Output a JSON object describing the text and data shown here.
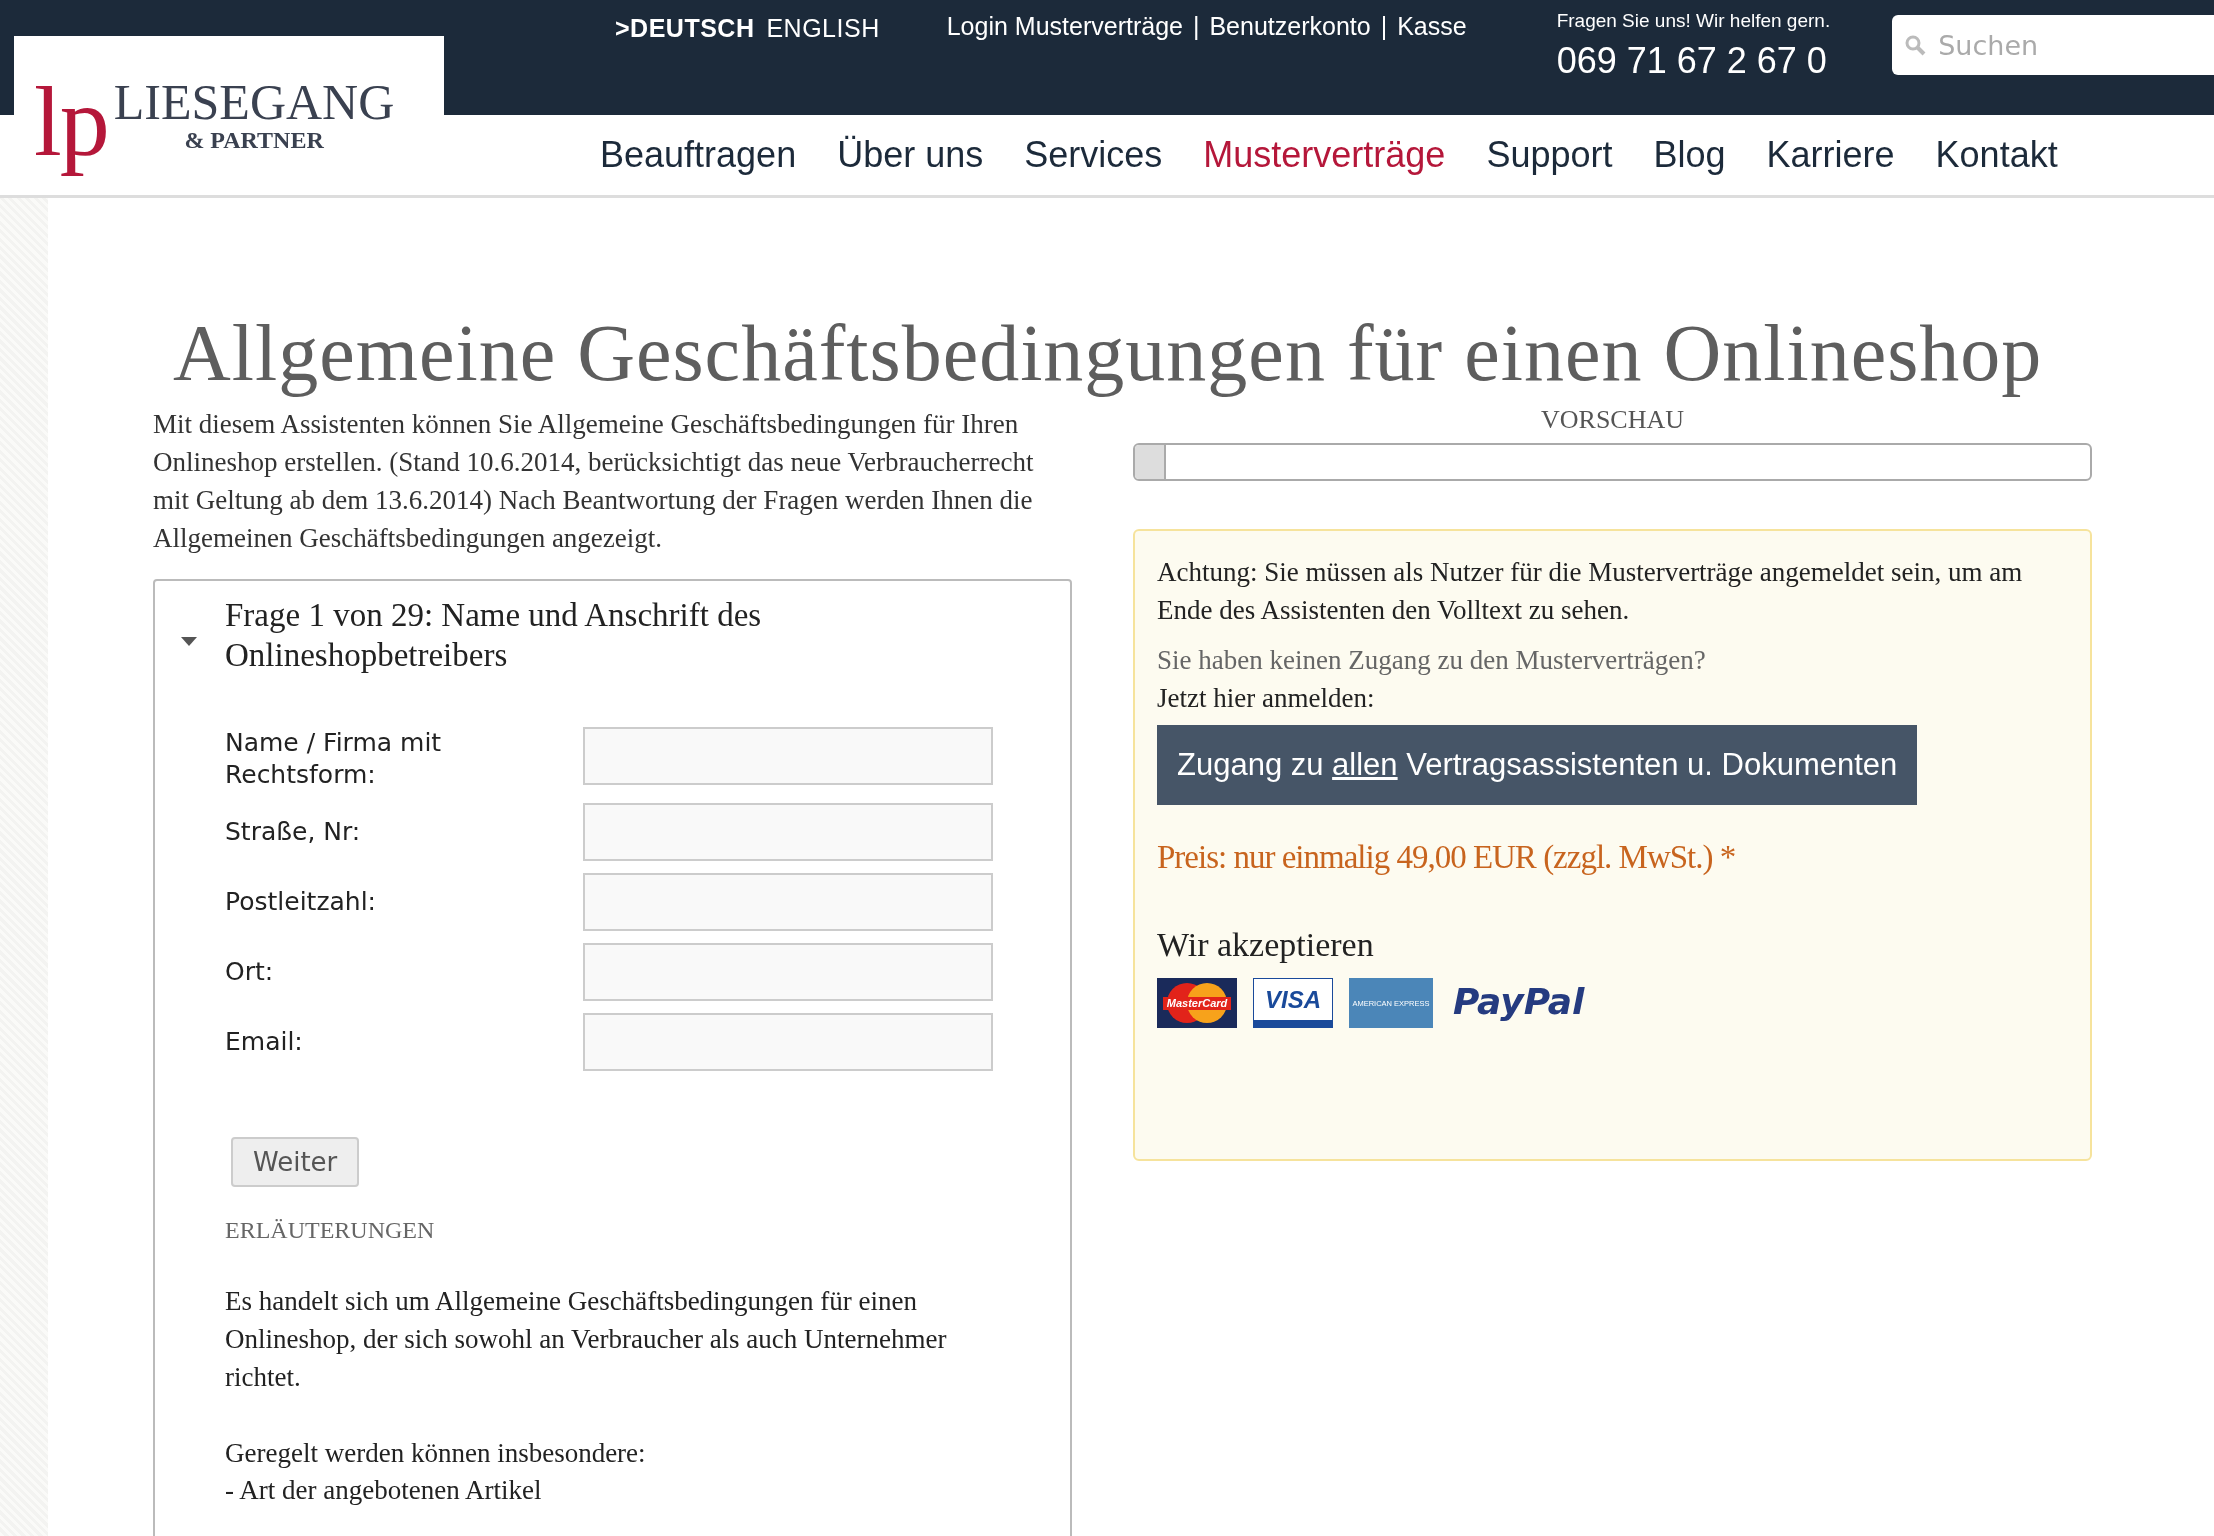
{
  "logo": {
    "initials": "lp",
    "name": "LIESEGANG",
    "subtitle": "& PARTNER"
  },
  "languages": [
    {
      "label": ">DEUTSCH",
      "selected": true
    },
    {
      "label": "ENGLISH",
      "selected": false
    }
  ],
  "account_links": [
    "Login Musterverträge",
    "Benutzerkonto",
    "Kasse"
  ],
  "link_separator": "|",
  "help_text": "Fragen Sie uns! Wir helfen gern.",
  "phone": "069 71 67 2 67 0",
  "search": {
    "placeholder": "Suchen"
  },
  "nav": [
    {
      "label": "Beauftragen",
      "selected": false
    },
    {
      "label": "Über uns",
      "selected": false
    },
    {
      "label": "Services",
      "selected": false
    },
    {
      "label": "Musterverträge",
      "selected": true
    },
    {
      "label": "Support",
      "selected": false
    },
    {
      "label": "Blog",
      "selected": false
    },
    {
      "label": "Karriere",
      "selected": false
    },
    {
      "label": "Kontakt",
      "selected": false
    }
  ],
  "page_title": "Allgemeine Geschäftsbedingungen für einen Onlineshop",
  "intro": "Mit diesem Assistenten können Sie Allgemeine Geschäftsbedingungen für Ihren Onlineshop erstellen. (Stand 10.6.2014, berücksichtigt das neue Verbraucherrecht mit Geltung ab dem 13.6.2014) Nach Beantwortung der Fragen werden Ihnen die Allgemeinen Geschäftsbedingungen angezeigt.",
  "question": {
    "title": "Frage 1 von 29: Name und Anschrift des Onlineshopbetreibers",
    "expanded": true,
    "fields": [
      {
        "label": "Name / Firma mit Rechtsform:"
      },
      {
        "label": "Straße, Nr:"
      },
      {
        "label": "Postleitzahl:"
      },
      {
        "label": "Ort:"
      },
      {
        "label": "Email:"
      }
    ],
    "button": "Weiter",
    "explanations_heading": "ERLÄUTERUNGEN",
    "explanations": [
      "Es handelt sich um Allgemeine Geschäftsbedingungen für einen Onlineshop, der sich sowohl an Verbraucher als auch Unternehmer richtet.",
      "Geregelt werden können insbesondere:"
    ],
    "list_items": [
      "- Art der angebotenen Artikel"
    ]
  },
  "preview": {
    "label": "VORSCHAU",
    "level": 0.03
  },
  "notice": {
    "warning": "Achtung: Sie müssen als Nutzer für die Musterverträge angemeldet sein, um am Ende des Assistenten den Volltext zu sehen.",
    "question": "Sie haben keinen Zugang zu den Musterverträgen?",
    "prompt": "Jetzt hier anmelden:",
    "button_parts": [
      {
        "text": "Zugang zu ",
        "underlined": false
      },
      {
        "text": "allen",
        "underlined": true
      },
      {
        "text": " Vertragsassistenten u. Dokumenten",
        "underlined": false
      }
    ],
    "price": "Preis: nur einmalig 49,00 EUR (zzgl. MwSt.) *",
    "accept_heading": "Wir akzeptieren",
    "payment_methods": [
      {
        "kind": "mastercard",
        "text": "MasterCard"
      },
      {
        "kind": "visa",
        "text": "VISA"
      },
      {
        "kind": "amex",
        "text": "AMERICAN EXPRESS"
      },
      {
        "kind": "paypal",
        "text": "PayPal"
      }
    ]
  }
}
